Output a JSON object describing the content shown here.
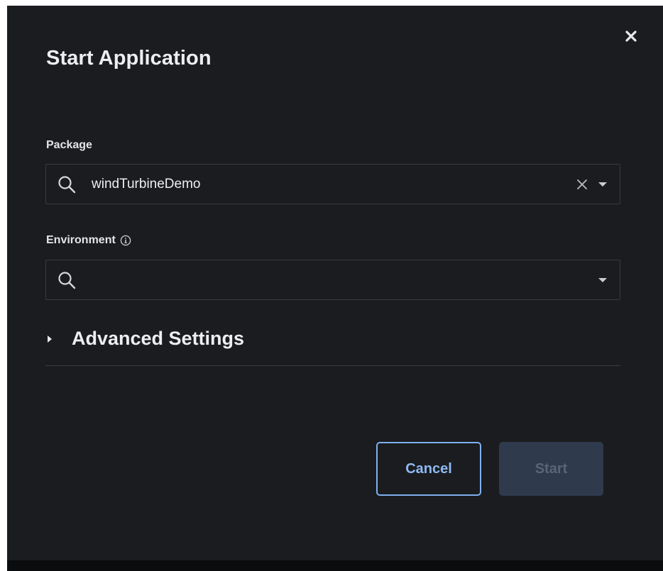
{
  "dialog": {
    "title": "Start Application",
    "close_icon": "close-icon"
  },
  "package": {
    "label": "Package",
    "value": "windTurbineDemo",
    "icons": [
      "search-icon",
      "clear-icon",
      "caret-down-icon"
    ]
  },
  "environment": {
    "label": "Environment",
    "info_icon": "info-icon",
    "value": "",
    "placeholder": "",
    "icons": [
      "search-icon",
      "caret-down-icon"
    ]
  },
  "advanced": {
    "label": "Advanced Settings",
    "expanded": false,
    "icon": "caret-right-icon"
  },
  "actions": {
    "cancel_label": "Cancel",
    "start_label": "Start",
    "start_enabled": false
  },
  "colors": {
    "dialog_bg": "#1b1c1f",
    "border": "#3a3c41",
    "accent": "#8db9f3",
    "disabled_button_bg": "#2f3a4c",
    "disabled_button_text": "#5a6477"
  }
}
